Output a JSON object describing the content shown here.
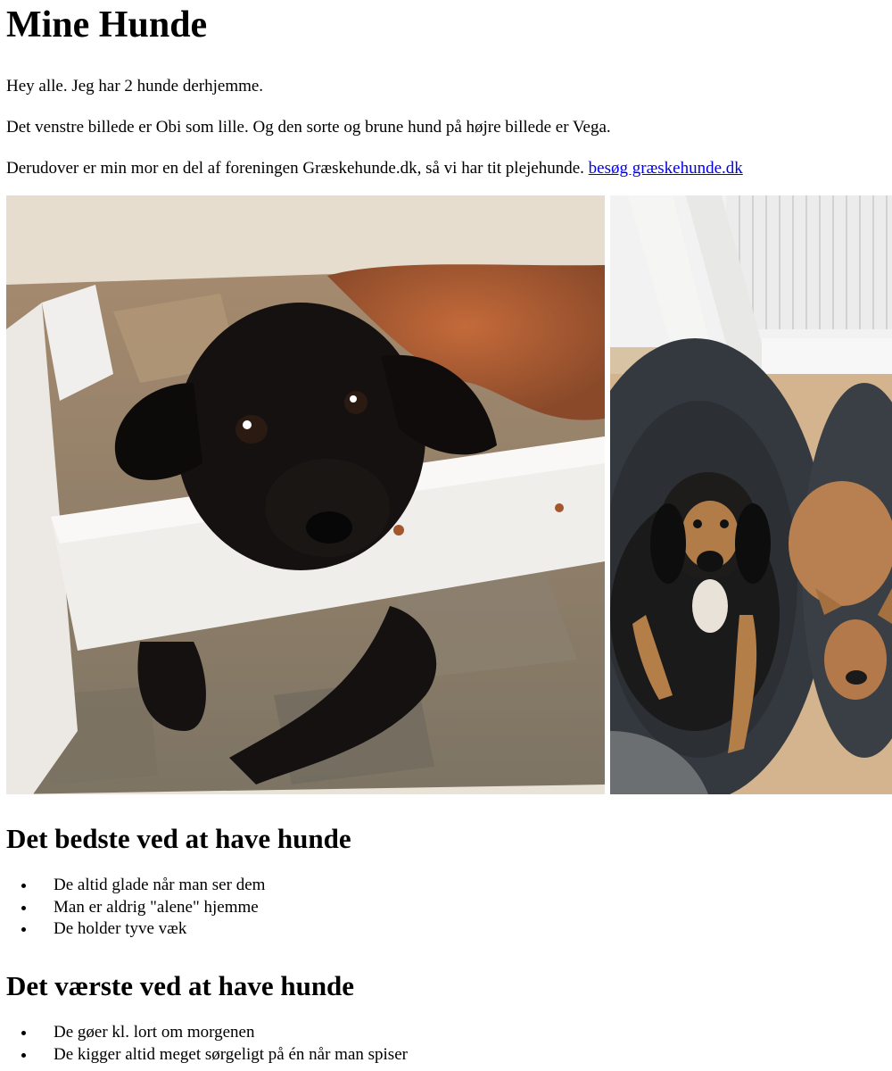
{
  "page": {
    "title": "Mine Hunde",
    "intro": [
      "Hey alle. Jeg har 2 hunde derhjemme.",
      "Det venstre billede er Obi som lille. Og den sorte og brune hund på højre billede er Vega.",
      "Derudover er min mor en del af foreningen Græskehunde.dk, så vi har tit plejehunde."
    ],
    "link_text": "besøg græskehunde.dk"
  },
  "photos": {
    "left_icon": "photo-puppy-obi",
    "right_icon": "photo-dogs-vega"
  },
  "best": {
    "heading": "Det bedste ved at have hunde",
    "items": [
      "De altid glade når man ser dem",
      "Man er aldrig \"alene\" hjemme",
      "De holder tyve væk"
    ]
  },
  "worst": {
    "heading": "Det værste ved at have hunde",
    "items": [
      "De gøer kl. lort om morgenen",
      "De kigger altid meget sørgeligt på én når man spiser"
    ]
  },
  "colors": {
    "link": "#0000ee",
    "text": "#000000",
    "background": "#ffffff"
  }
}
